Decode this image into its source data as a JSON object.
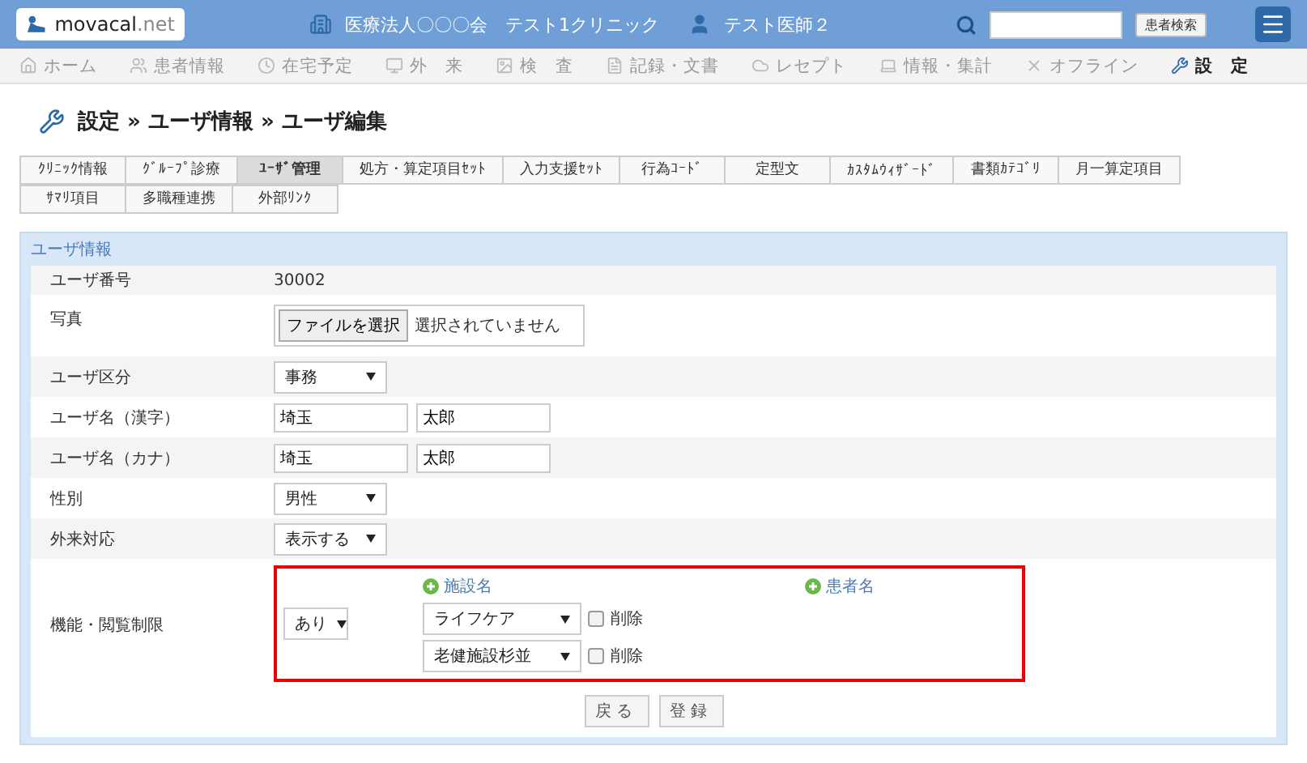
{
  "header": {
    "logo_name": "movacal",
    "logo_suffix": ".net",
    "clinic": "医療法人〇〇〇会　テスト1クリニック",
    "user": "テスト医師２",
    "search_button": "患者検索"
  },
  "nav": [
    {
      "label": "ホーム",
      "selected": false
    },
    {
      "label": "患者情報",
      "selected": false
    },
    {
      "label": "在宅予定",
      "selected": false
    },
    {
      "label": "外　来",
      "selected": false
    },
    {
      "label": "検　査",
      "selected": false
    },
    {
      "label": "記録・文書",
      "selected": false
    },
    {
      "label": "レセプト",
      "selected": false
    },
    {
      "label": "情報・集計",
      "selected": false
    },
    {
      "label": "オフライン",
      "selected": false
    },
    {
      "label": "設　定",
      "selected": true
    }
  ],
  "breadcrumb": "設定 » ユーザ情報 » ユーザ編集",
  "tabs": [
    [
      {
        "label": "ｸﾘﾆｯｸ情報",
        "selected": false
      },
      {
        "label": "ｸﾞﾙｰﾌﾟ診療",
        "selected": false
      },
      {
        "label": "ﾕｰｻﾞ管理",
        "selected": true
      },
      {
        "label": "処方・算定項目ｾｯﾄ",
        "selected": false
      },
      {
        "label": "入力支援ｾｯﾄ",
        "selected": false
      },
      {
        "label": "行為ｺｰﾄﾞ",
        "selected": false
      },
      {
        "label": "定型文",
        "selected": false
      },
      {
        "label": "ｶｽﾀﾑｳｨｻﾞｰﾄﾞ",
        "selected": false
      },
      {
        "label": "書類ｶﾃｺﾞﾘ",
        "selected": false
      },
      {
        "label": "月一算定項目",
        "selected": false
      }
    ],
    [
      {
        "label": "ｻﾏﾘ項目",
        "selected": false
      },
      {
        "label": "多職種連携",
        "selected": false
      },
      {
        "label": "外部ﾘﾝｸ",
        "selected": false
      }
    ]
  ],
  "panel": {
    "title": "ユーザ情報",
    "rows": [
      {
        "kind": "text",
        "label": "ユーザ番号",
        "value": "30002"
      },
      {
        "kind": "file",
        "label": "写真",
        "button": "ファイルを選択",
        "status": "選択されていません"
      },
      {
        "kind": "select",
        "label": "ユーザ区分",
        "value": "事務"
      },
      {
        "kind": "pair",
        "label": "ユーザ名（漢字）",
        "first": "埼玉",
        "last": "太郎"
      },
      {
        "kind": "pair",
        "label": "ユーザ名（カナ）",
        "first": "埼玉",
        "last": "太郎"
      },
      {
        "kind": "select",
        "label": "性別",
        "value": "男性"
      },
      {
        "kind": "select",
        "label": "外来対応",
        "value": "表示する"
      }
    ],
    "restriction": {
      "label": "機能・閲覧制限",
      "value": "あり",
      "facility_link": "施設名",
      "patient_link": "患者名",
      "facilities": [
        {
          "value": "ライフケア",
          "delete_label": "削除",
          "checked": false
        },
        {
          "value": "老健施設杉並",
          "delete_label": "削除",
          "checked": false
        }
      ]
    },
    "buttons": [
      "戻る",
      "登録"
    ]
  }
}
